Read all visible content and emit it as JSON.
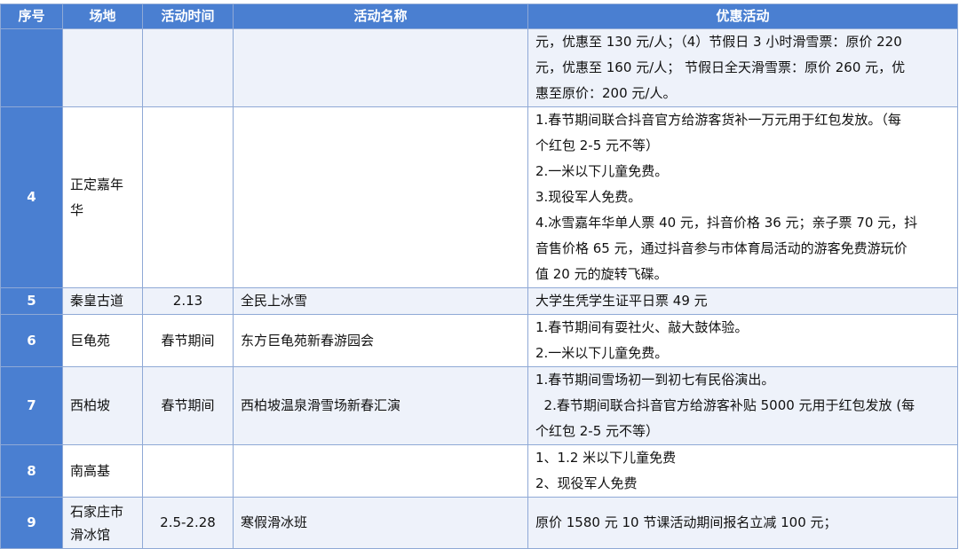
{
  "header": {
    "no": "序号",
    "venue": "场地",
    "time": "活动时间",
    "name": "活动名称",
    "offer": "优惠活动"
  },
  "rows": [
    {
      "no": "",
      "venue": "",
      "time": "",
      "name": "",
      "offer_lines": [
        "元，优惠至 130 元/人；（4）节假日 3 小时滑雪票：原价 220",
        "元，优惠至 160 元/人；  节假日全天滑雪票：原价 260 元，优",
        "惠至原价：200 元/人。"
      ]
    },
    {
      "no": "4",
      "venue": "正定嘉年华",
      "time": "",
      "name": "",
      "offer_lines": [
        "1.春节期间联合抖音官方给游客货补一万元用于红包发放。（每",
        "个红包 2-5 元不等）",
        "2.一米以下儿童免费。",
        "3.现役军人免费。",
        "4.冰雪嘉年华单人票 40 元，抖音价格 36 元；亲子票 70 元，抖",
        "音售价格 65 元，通过抖音参与市体育局活动的游客免费游玩价",
        "值 20 元的旋转飞碟。"
      ]
    },
    {
      "no": "5",
      "venue": "秦皇古道",
      "time": "2.13",
      "name": "全民上冰雪",
      "offer_lines": [
        "大学生凭学生证平日票 49 元"
      ]
    },
    {
      "no": "6",
      "venue": "巨龟苑",
      "time": "春节期间",
      "name": "东方巨龟苑新春游园会",
      "offer_lines": [
        "1.春节期间有耍社火、敲大鼓体验。",
        "2.一米以下儿童免费。"
      ]
    },
    {
      "no": "7",
      "venue": "西柏坡",
      "time": "春节期间",
      "name": "西柏坡温泉滑雪场新春汇演",
      "offer_lines": [
        "1.春节期间雪场初一到初七有民俗演出。",
        "  2.春节期间联合抖音官方给游客补贴 5000 元用于红包发放 (每",
        "个红包 2-5 元不等）"
      ]
    },
    {
      "no": "8",
      "venue": "南高基",
      "time": "",
      "name": "",
      "offer_lines": [
        "1、1.2 米以下儿童免费",
        "2、现役军人免费"
      ]
    },
    {
      "no": "9",
      "venue": "石家庄市滑冰馆",
      "time": "2.5-2.28",
      "name": "寒假滑冰班",
      "offer_lines": [
        "原价 1580 元 10 节课活动期间报名立减 100 元；"
      ]
    }
  ]
}
